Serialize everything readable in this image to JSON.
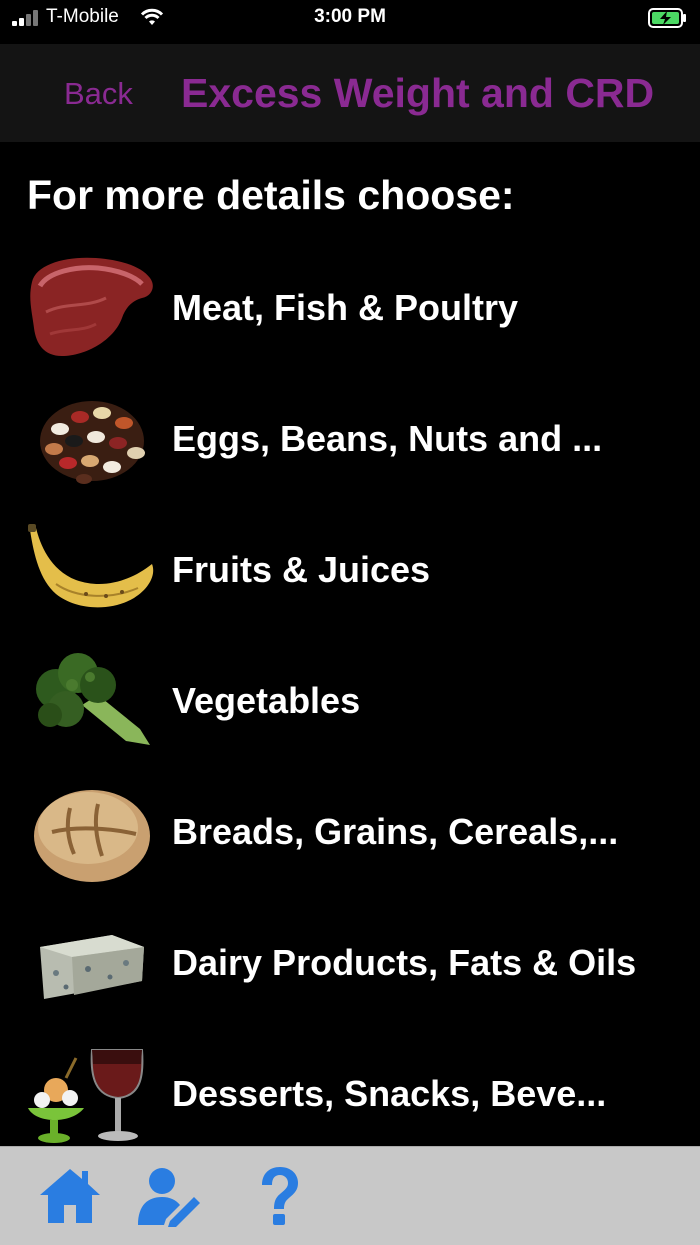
{
  "status": {
    "carrier": "T-Mobile",
    "time": "3:00 PM"
  },
  "nav": {
    "back_label": "Back",
    "title": "Excess Weight and CRD"
  },
  "prompt": "For more details choose:",
  "categories": [
    {
      "label": "Meat, Fish & Poultry",
      "icon": "steak-icon"
    },
    {
      "label": "Eggs, Beans, Nuts and ...",
      "icon": "beans-icon"
    },
    {
      "label": "Fruits & Juices",
      "icon": "banana-icon"
    },
    {
      "label": "Vegetables",
      "icon": "broccoli-icon"
    },
    {
      "label": "Breads, Grains, Cereals,...",
      "icon": "bread-icon"
    },
    {
      "label": "Dairy Products, Fats & Oils",
      "icon": "cheese-icon"
    },
    {
      "label": "Desserts, Snacks, Beve...",
      "icon": "dessert-wine-icon"
    }
  ],
  "tabbar": {
    "items": [
      "home-icon",
      "profile-edit-icon",
      "help-icon"
    ]
  },
  "colors": {
    "accent": "#8a2a92",
    "tab_icon": "#2a7de1",
    "background": "#000000",
    "nav_background": "#141414",
    "tabbar_background": "#c8c8c8"
  }
}
